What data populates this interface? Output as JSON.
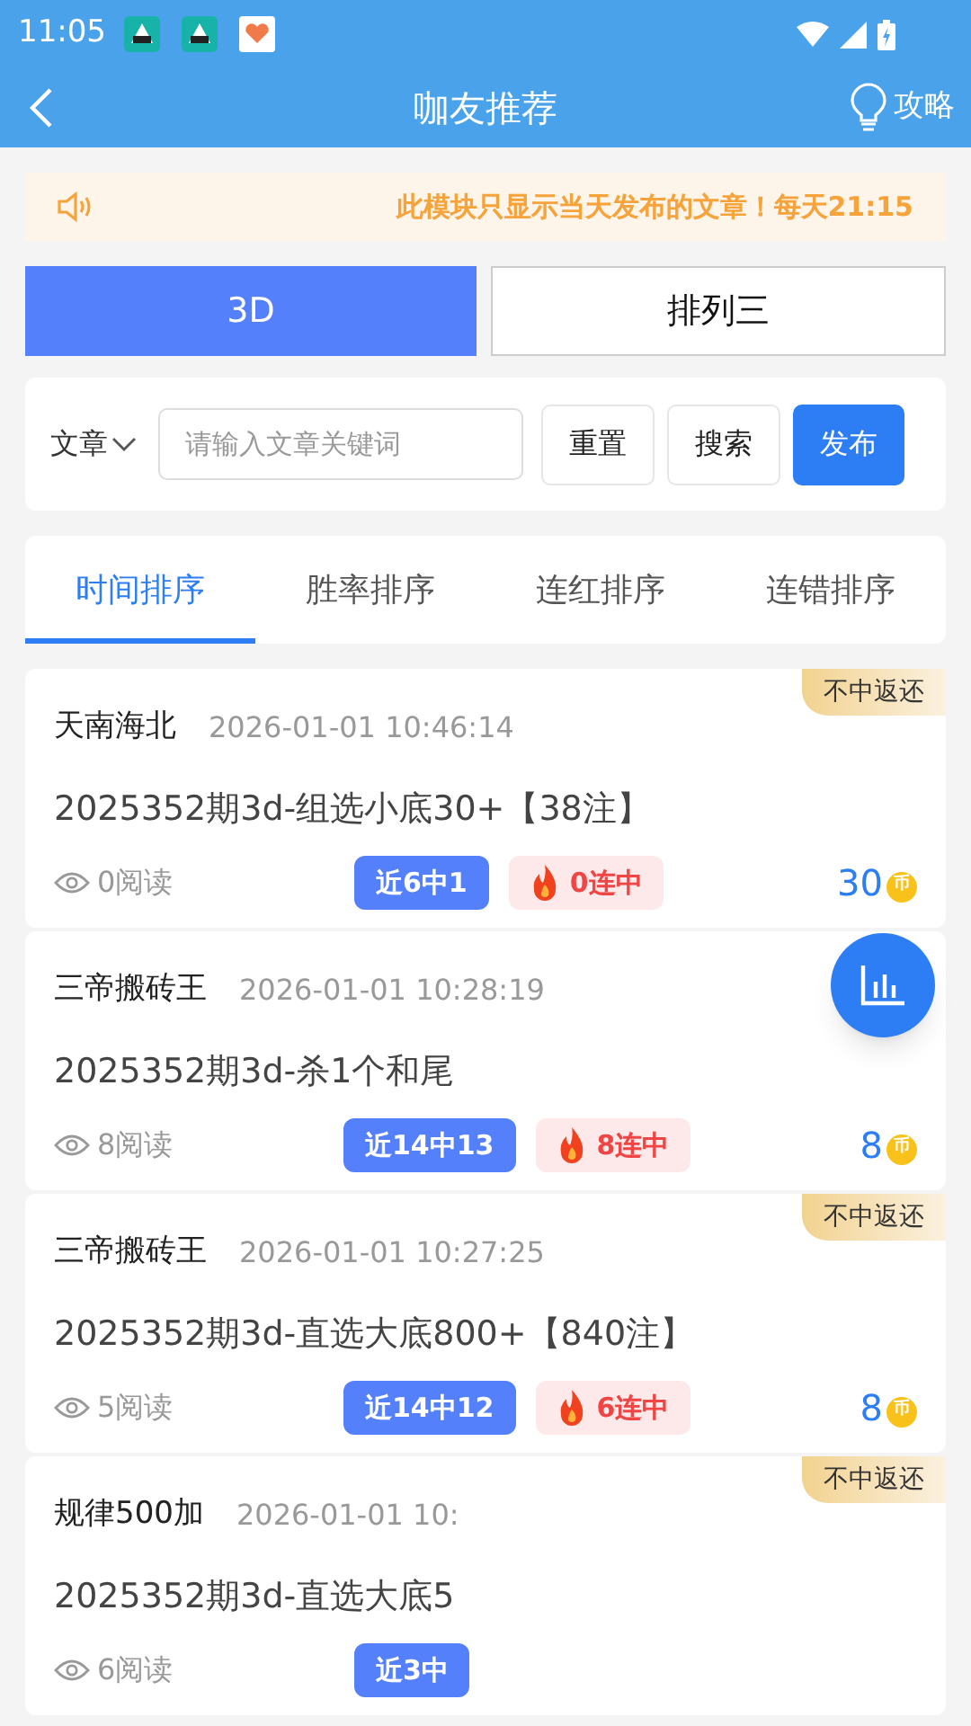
{
  "status_bar": {
    "time": "11:05"
  },
  "header": {
    "title": "咖友推荐",
    "guide": "攻略"
  },
  "notice": "此模块只显示当天发布的文章！每天21:15",
  "lottery_tabs": [
    {
      "label": "3D",
      "selected": true
    },
    {
      "label": "排列三",
      "selected": false
    }
  ],
  "filter": {
    "type": "文章",
    "placeholder": "请输入文章关键词",
    "buttons": [
      {
        "label": "重置",
        "kind": "plain"
      },
      {
        "label": "搜索",
        "kind": "plain"
      },
      {
        "label": "发布",
        "kind": "primary"
      }
    ]
  },
  "sort_tabs": [
    {
      "label": "时间排序",
      "selected": true
    },
    {
      "label": "胜率排序",
      "selected": false
    },
    {
      "label": "连红排序",
      "selected": false
    },
    {
      "label": "连错排序",
      "selected": false
    }
  ],
  "articles": [
    {
      "author": "天南海北",
      "time": "2026-01-01 10:46:14",
      "tag": "不中返还",
      "title": "2025352期3d-组选小底30+【38注】",
      "reads": "0阅读",
      "record": "近6中1",
      "streak": "0连中",
      "price": "30",
      "coin": "币"
    },
    {
      "author": "三帝搬砖王",
      "time": "2026-01-01 10:28:19",
      "title": "2025352期3d-杀1个和尾",
      "reads": "8阅读",
      "record": "近14中13",
      "streak": "8连中",
      "price": "8",
      "coin": "币"
    },
    {
      "author": "三帝搬砖王",
      "time": "2026-01-01 10:27:25",
      "tag": "不中返还",
      "title": "2025352期3d-直选大底800+【840注】",
      "reads": "5阅读",
      "record": "近14中12",
      "streak": "6连中",
      "price": "8",
      "coin": "币"
    },
    {
      "author": "规律500加",
      "time": "2026-01-01 10:",
      "tag": "不中返还",
      "title": "2025352期3d-直选大底5",
      "reads": "6阅读",
      "record": "近3中"
    }
  ]
}
